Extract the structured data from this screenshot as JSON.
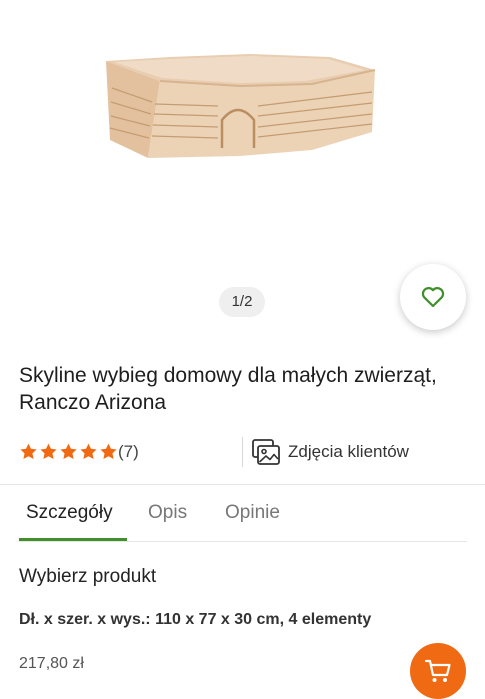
{
  "gallery": {
    "pager": "1/2"
  },
  "product": {
    "title": "Skyline wybieg domowy dla małych zwierząt, Ranczo Arizona",
    "rating": 5,
    "reviews_count": "(7)",
    "customer_photos_label": "Zdjęcia klientów"
  },
  "tabs": [
    {
      "label": "Szczegóły",
      "active": true
    },
    {
      "label": "Opis",
      "active": false
    },
    {
      "label": "Opinie",
      "active": false
    }
  ],
  "details": {
    "choose_label": "Wybierz produkt",
    "variant": "Dł. x szer. x wys.: 110 x 77 x 30 cm, 4 elementy",
    "price": "217,80 zł"
  },
  "icons": {
    "favorite": "heart-outline-icon",
    "star": "star-icon",
    "photos": "image-gallery-icon",
    "cart": "shopping-cart-icon"
  },
  "colors": {
    "accent_green": "#3f8f2a",
    "star_orange": "#f06a13",
    "cart_orange": "#f06a13"
  }
}
